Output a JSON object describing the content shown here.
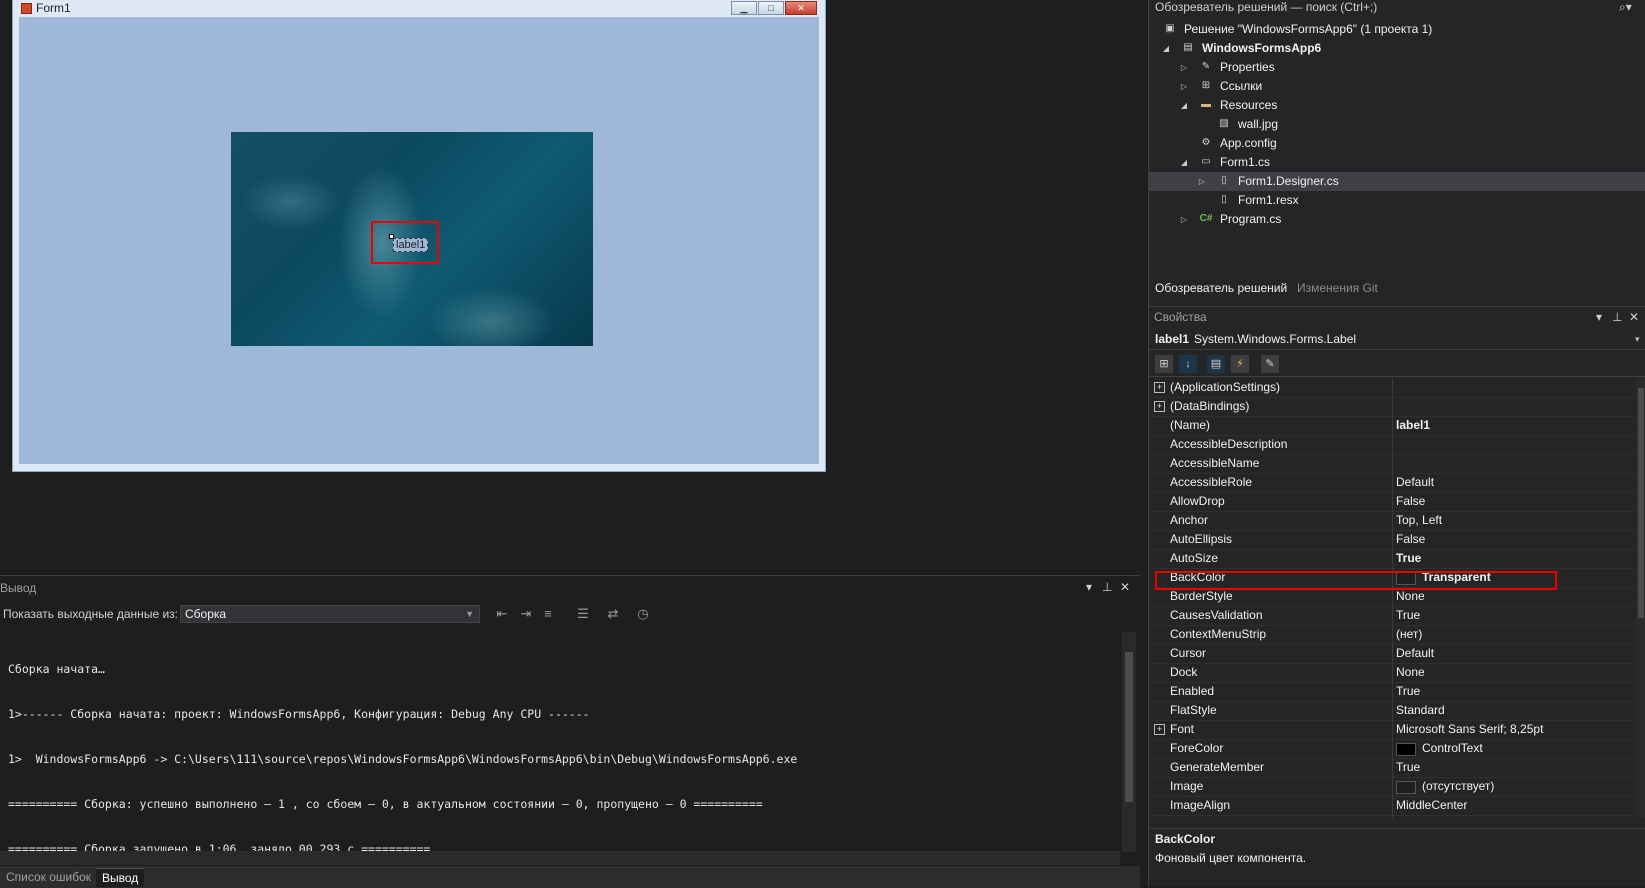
{
  "designer": {
    "form_title": "Form1",
    "label_text": "label1"
  },
  "output": {
    "title": "Вывод",
    "show_label": "Показать выходные данные из:",
    "source": "Сборка",
    "lines": [
      "Сборка начата…",
      "1>------ Сборка начата: проект: WindowsFormsApp6, Конфигурация: Debug Any CPU ------",
      "1>  WindowsFormsApp6 -> C:\\Users\\111\\source\\repos\\WindowsFormsApp6\\WindowsFormsApp6\\bin\\Debug\\WindowsFormsApp6.exe",
      "========== Сборка: успешно выполнено — 1 , со сбоем — 0, в актуальном состоянии — 0, пропущено — 0 ==========",
      "========== Сборка запущено в 1:06, заняло 00,293 с =========="
    ],
    "tabs": [
      "Список ошибок",
      "Вывод"
    ]
  },
  "solution": {
    "header": "Обозреватель решений — поиск (Ctrl+;)",
    "items": [
      {
        "label": "Решение \"WindowsFormsApp6\" (1 проекта 1)",
        "icon": "solution-icon"
      },
      {
        "label": "WindowsFormsApp6",
        "icon": "csharp-project-icon"
      },
      {
        "label": "Properties",
        "icon": "wrench-icon"
      },
      {
        "label": "Ссылки",
        "icon": "references-icon"
      },
      {
        "label": "Resources",
        "icon": "folder-icon"
      },
      {
        "label": "wall.jpg",
        "icon": "image-file-icon"
      },
      {
        "label": "App.config",
        "icon": "config-file-icon"
      },
      {
        "label": "Form1.cs",
        "icon": "form-icon"
      },
      {
        "label": "Form1.Designer.cs",
        "icon": "file-icon"
      },
      {
        "label": "Form1.resx",
        "icon": "file-icon"
      },
      {
        "label": "Program.cs",
        "icon": "csharp-file-icon"
      }
    ],
    "tabs": [
      "Обозреватель решений",
      "Изменения Git"
    ]
  },
  "properties": {
    "header": "Свойства",
    "object_name": "label1",
    "object_type": "System.Windows.Forms.Label",
    "rows": [
      {
        "name": "(ApplicationSettings)",
        "value": ""
      },
      {
        "name": "(DataBindings)",
        "value": ""
      },
      {
        "name": "(Name)",
        "value": "label1"
      },
      {
        "name": "AccessibleDescription",
        "value": ""
      },
      {
        "name": "AccessibleName",
        "value": ""
      },
      {
        "name": "AccessibleRole",
        "value": "Default"
      },
      {
        "name": "AllowDrop",
        "value": "False"
      },
      {
        "name": "Anchor",
        "value": "Top, Left"
      },
      {
        "name": "AutoEllipsis",
        "value": "False"
      },
      {
        "name": "AutoSize",
        "value": "True"
      },
      {
        "name": "BackColor",
        "value": "Transparent"
      },
      {
        "name": "BorderStyle",
        "value": "None"
      },
      {
        "name": "CausesValidation",
        "value": "True"
      },
      {
        "name": "ContextMenuStrip",
        "value": "(нет)"
      },
      {
        "name": "Cursor",
        "value": "Default"
      },
      {
        "name": "Dock",
        "value": "None"
      },
      {
        "name": "Enabled",
        "value": "True"
      },
      {
        "name": "FlatStyle",
        "value": "Standard"
      },
      {
        "name": "Font",
        "value": "Microsoft Sans Serif; 8,25pt"
      },
      {
        "name": "ForeColor",
        "value": "ControlText"
      },
      {
        "name": "GenerateMember",
        "value": "True"
      },
      {
        "name": "Image",
        "value": "(отсутствует)"
      },
      {
        "name": "ImageAlign",
        "value": "MiddleCenter"
      }
    ],
    "description_title": "BackColor",
    "description_text": "Фоновый цвет компонента."
  }
}
